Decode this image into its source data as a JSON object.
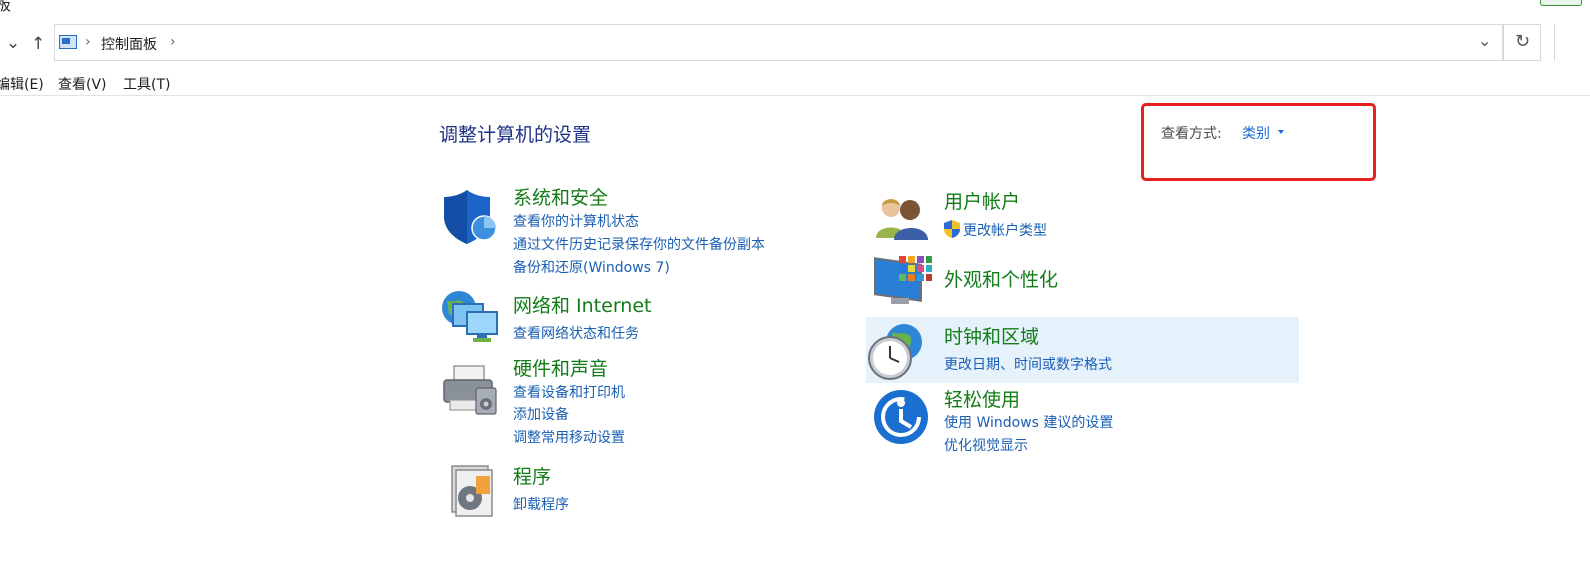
{
  "window": {
    "title_fragment": "板"
  },
  "nav": {
    "back_dropdown": "⌄",
    "up": "↑",
    "breadcrumb": [
      "控制面板"
    ],
    "separator": "›",
    "address_dropdown": "⌄",
    "refresh": "↻"
  },
  "menu": [
    "编辑(E)",
    "查看(V)",
    "工具(T)"
  ],
  "header": {
    "title": "调整计算机的设置",
    "view_by_label": "查看方式:",
    "view_by_value": "类别"
  },
  "categories_left": [
    {
      "title": "系统和安全",
      "icon": "shield-icon",
      "links": [
        "查看你的计算机状态",
        "通过文件历史记录保存你的文件备份副本",
        "备份和还原(Windows 7)"
      ]
    },
    {
      "title": "网络和 Internet",
      "icon": "network-icon",
      "links": [
        "查看网络状态和任务"
      ]
    },
    {
      "title": "硬件和声音",
      "icon": "printer-icon",
      "links": [
        "查看设备和打印机",
        "添加设备",
        "调整常用移动设置"
      ]
    },
    {
      "title": "程序",
      "icon": "programs-icon",
      "links": [
        "卸载程序"
      ]
    }
  ],
  "categories_right": [
    {
      "title": "用户帐户",
      "icon": "users-icon",
      "links": [
        "更改帐户类型"
      ]
    },
    {
      "title": "外观和个性化",
      "icon": "appearance-icon",
      "links": []
    },
    {
      "title": "时钟和区域",
      "icon": "clock-globe-icon",
      "links": [
        "更改日期、时间或数字格式"
      ]
    },
    {
      "title": "轻松使用",
      "icon": "ease-of-access-icon",
      "links": [
        "使用 Windows 建议的设置",
        "优化视觉显示"
      ]
    }
  ],
  "colors": {
    "title_green": "#127c16",
    "link_blue": "#1a5fb4",
    "highlight_red": "#e5201f",
    "hover": "#e5f1fb"
  }
}
